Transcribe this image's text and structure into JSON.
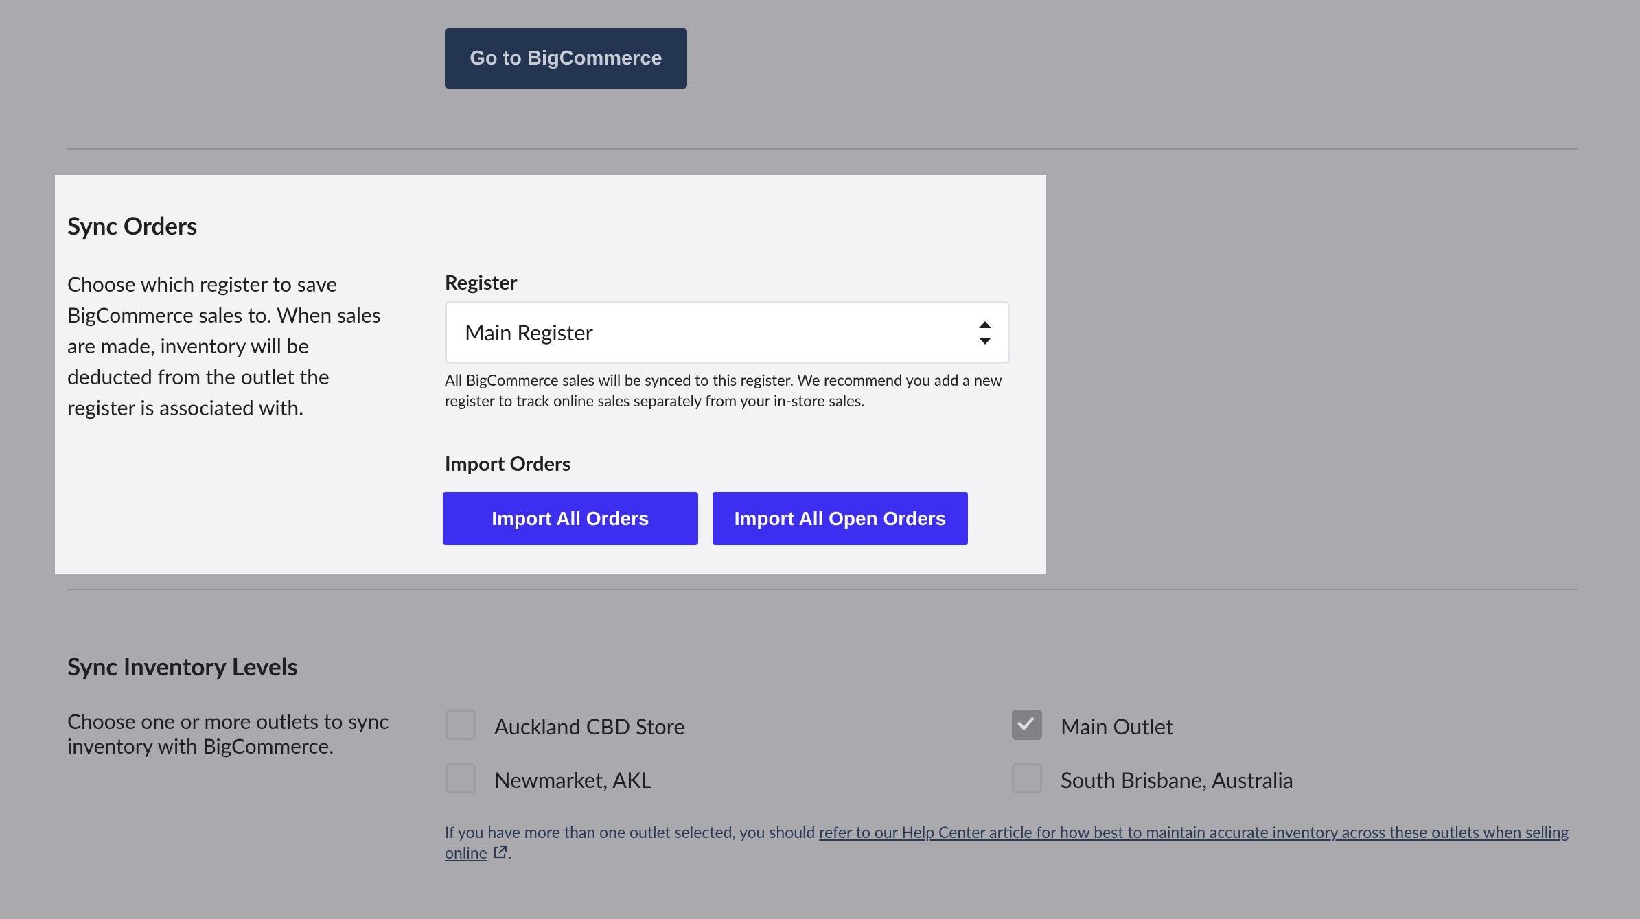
{
  "top_button": {
    "label": "Go to BigCommerce"
  },
  "sync_orders": {
    "title": "Sync Orders",
    "description": "Choose which register to save BigCommerce sales to. When sales are made, inventory will be deducted from the outlet the register is associated with.",
    "register_label": "Register",
    "register_value": "Main Register",
    "register_help": "All BigCommerce sales will be synced to this register. We recommend you add a new register to track online sales separately from your in-store sales.",
    "import_label": "Import Orders",
    "import_all_label": "Import All Orders",
    "import_open_label": "Import All Open Orders"
  },
  "sync_inventory": {
    "title": "Sync Inventory Levels",
    "description": "Choose one or more outlets to sync inventory with BigCommerce.",
    "outlets": [
      {
        "label": "Auckland CBD Store",
        "checked": false
      },
      {
        "label": "Main Outlet",
        "checked": true
      },
      {
        "label": "Newmarket, AKL",
        "checked": false
      },
      {
        "label": "South Brisbane, Australia",
        "checked": false
      }
    ],
    "footnote_prefix": "If you have more than one outlet selected, you should ",
    "footnote_link": "refer to our Help Center article for how best to maintain accurate inventory across these outlets when selling online",
    "footnote_suffix": "."
  },
  "colors": {
    "background": "#aaa9ad",
    "panel": "#f3f2f5",
    "primary_blue": "#3c2ff0",
    "dark_button": "#243552"
  },
  "icons": [
    "sort-arrows-icon",
    "checkmark-icon",
    "external-link-icon"
  ]
}
